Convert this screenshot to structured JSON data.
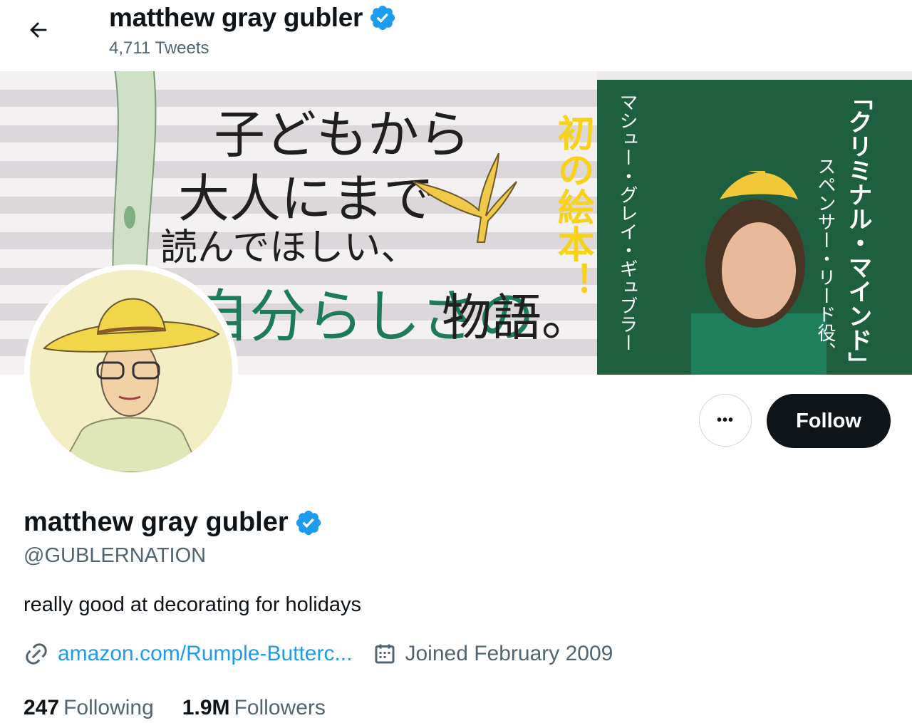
{
  "header": {
    "name": "matthew gray gubler",
    "tweet_count": "4,711 Tweets"
  },
  "banner": {
    "line1": "子どもから",
    "line2": "大人にまで",
    "line3": "読んでほしい、",
    "line4": "自分らしさの",
    "line5": "物語。",
    "vertical_yellow": "初の絵本！",
    "vertical_name": "マシュー・グレイ・ギュブラー",
    "vertical_title": "「クリミナル・マインド」",
    "vertical_role": "スペンサー・リード役、"
  },
  "actions": {
    "more_label": "•••",
    "follow_label": "Follow"
  },
  "profile": {
    "name": "matthew gray gubler",
    "handle": "@GUBLERNATION",
    "bio": "really good at decorating for holidays",
    "link": "amazon.com/Rumple-Butterc...",
    "joined": "Joined February 2009",
    "following_count": "247",
    "following_label": "Following",
    "followers_count": "1.9M",
    "followers_label": "Followers"
  },
  "colors": {
    "accent": "#1d9bf0",
    "text": "#0f1419",
    "muted": "#536471",
    "follow_bg": "#0f1419"
  }
}
